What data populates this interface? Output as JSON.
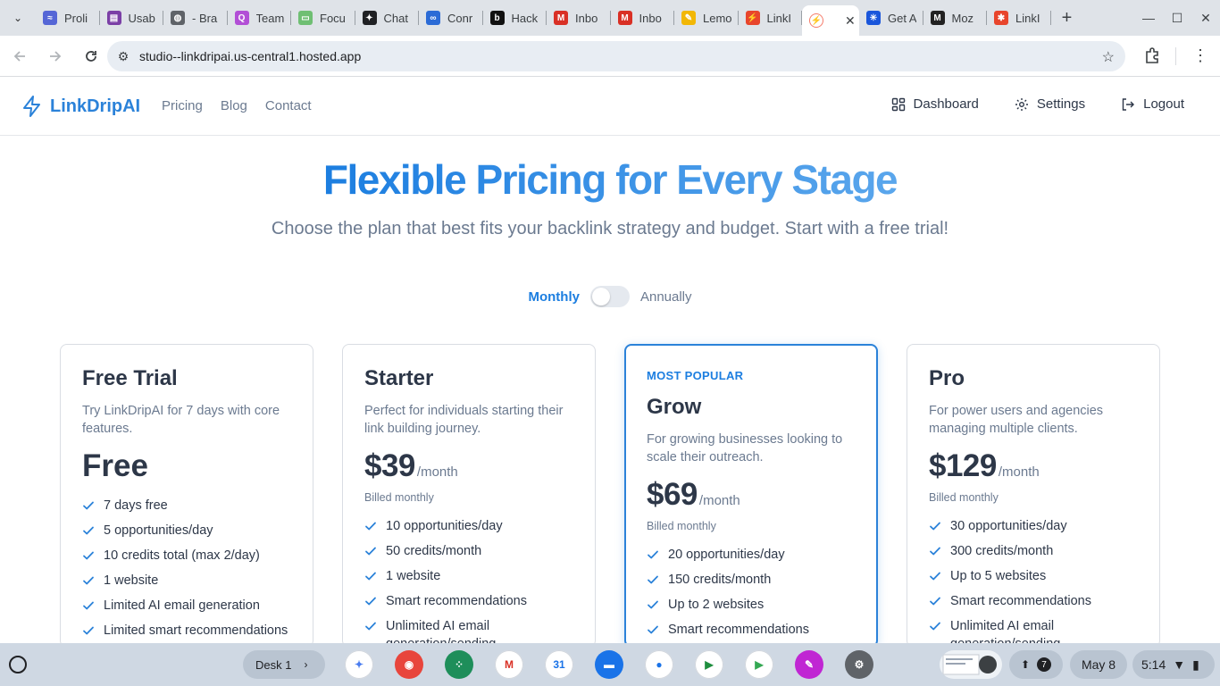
{
  "browser": {
    "tabs": [
      {
        "title": "Proli",
        "fav_color": "#5566d6",
        "fav_text": "≈"
      },
      {
        "title": "Usab",
        "fav_color": "#7b3fa6",
        "fav_text": "▤"
      },
      {
        "title": "- Bra",
        "fav_color": "#5f6368",
        "fav_text": "◍"
      },
      {
        "title": "Team",
        "fav_color": "#b24fd6",
        "fav_text": "Q"
      },
      {
        "title": "Focu",
        "fav_color": "#6fbf73",
        "fav_text": "▭"
      },
      {
        "title": "Chat",
        "fav_color": "#202124",
        "fav_text": "✦"
      },
      {
        "title": "Conr",
        "fav_color": "#2b6bd6",
        "fav_text": "∞"
      },
      {
        "title": "Hack",
        "fav_color": "#111111",
        "fav_text": "b"
      },
      {
        "title": "Inbo",
        "fav_color": "#d93025",
        "fav_text": "M"
      },
      {
        "title": "Inbo",
        "fav_color": "#d93025",
        "fav_text": "M"
      },
      {
        "title": "Lemo",
        "fav_color": "#f2b705",
        "fav_text": "✎"
      },
      {
        "title": "LinkI",
        "fav_color": "#e8452c",
        "fav_text": "⚡"
      }
    ],
    "active_tab": {
      "title": "",
      "fav_color": "#f57c6b",
      "fav_text": "⚡",
      "close": "✕"
    },
    "tabs_after": [
      {
        "title": "Get A",
        "fav_color": "#1a56db",
        "fav_text": "✳"
      },
      {
        "title": "Moz",
        "fav_color": "#222222",
        "fav_text": "M"
      },
      {
        "title": "LinkI",
        "fav_color": "#e8452c",
        "fav_text": "✱"
      }
    ],
    "new_tab": "+",
    "url": "studio--linkdripai.us-central1.hosted.app"
  },
  "site": {
    "brand": "LinkDripAI",
    "nav": {
      "pricing": "Pricing",
      "blog": "Blog",
      "contact": "Contact"
    },
    "right_nav": {
      "dashboard": "Dashboard",
      "settings": "Settings",
      "logout": "Logout"
    },
    "accent": "#2b82d9"
  },
  "hero": {
    "title": "Flexible Pricing for Every Stage",
    "subtitle": "Choose the plan that best fits your backlink strategy and budget. Start with a free trial!"
  },
  "billing": {
    "monthly": "Monthly",
    "annually": "Annually",
    "annual_selected": false
  },
  "plans": [
    {
      "name": "Free Trial",
      "description": "Try LinkDripAI for 7 days with core features.",
      "price": "Free",
      "features": [
        "7 days free",
        "5 opportunities/day",
        "10 credits total (max 2/day)",
        "1 website",
        "Limited AI email generation",
        "Limited smart recommendations"
      ]
    },
    {
      "name": "Starter",
      "description": "Perfect for individuals starting their link building journey.",
      "price": "$39",
      "period": "/month",
      "billed": "Billed monthly",
      "features": [
        "10 opportunities/day",
        "50 credits/month",
        "1 website",
        "Smart recommendations",
        "Unlimited AI email generation/sending"
      ]
    },
    {
      "badge": "MOST POPULAR",
      "name": "Grow",
      "description": "For growing businesses looking to scale their outreach.",
      "price": "$69",
      "period": "/month",
      "billed": "Billed monthly",
      "features": [
        "20 opportunities/day",
        "150 credits/month",
        "Up to 2 websites",
        "Smart recommendations"
      ]
    },
    {
      "name": "Pro",
      "description": "For power users and agencies managing multiple clients.",
      "price": "$129",
      "period": "/month",
      "billed": "Billed monthly",
      "features": [
        "30 opportunities/day",
        "300 credits/month",
        "Up to 5 websites",
        "Smart recommendations",
        "Unlimited AI email generation/sending"
      ]
    }
  ],
  "shelf": {
    "desk": "Desk 1",
    "apps": [
      {
        "name": "gemini",
        "color": "#ffffff",
        "glyph": "✦",
        "fg": "#4a7df0"
      },
      {
        "name": "chrome",
        "color": "#e8453c",
        "glyph": "◉",
        "fg": "#ffffff"
      },
      {
        "name": "apps",
        "color": "#1e8e5a",
        "glyph": "⁘",
        "fg": "#ffffff"
      },
      {
        "name": "gmail",
        "color": "#ffffff",
        "glyph": "M",
        "fg": "#d93025"
      },
      {
        "name": "calendar",
        "color": "#ffffff",
        "glyph": "31",
        "fg": "#1a73e8"
      },
      {
        "name": "files",
        "color": "#1a73e8",
        "glyph": "▬",
        "fg": "#ffffff"
      },
      {
        "name": "messages",
        "color": "#ffffff",
        "glyph": "●",
        "fg": "#1a73e8"
      },
      {
        "name": "meet",
        "color": "#ffffff",
        "glyph": "▶",
        "fg": "#1e8e3e"
      },
      {
        "name": "play-store",
        "color": "#ffffff",
        "glyph": "▶",
        "fg": "#34a853"
      },
      {
        "name": "notes",
        "color": "#c026d3",
        "glyph": "✎",
        "fg": "#ffffff"
      },
      {
        "name": "settings",
        "color": "#5f6368",
        "glyph": "⚙",
        "fg": "#ffffff"
      }
    ],
    "notifications": "7",
    "date": "May 8",
    "time": "5:14"
  }
}
